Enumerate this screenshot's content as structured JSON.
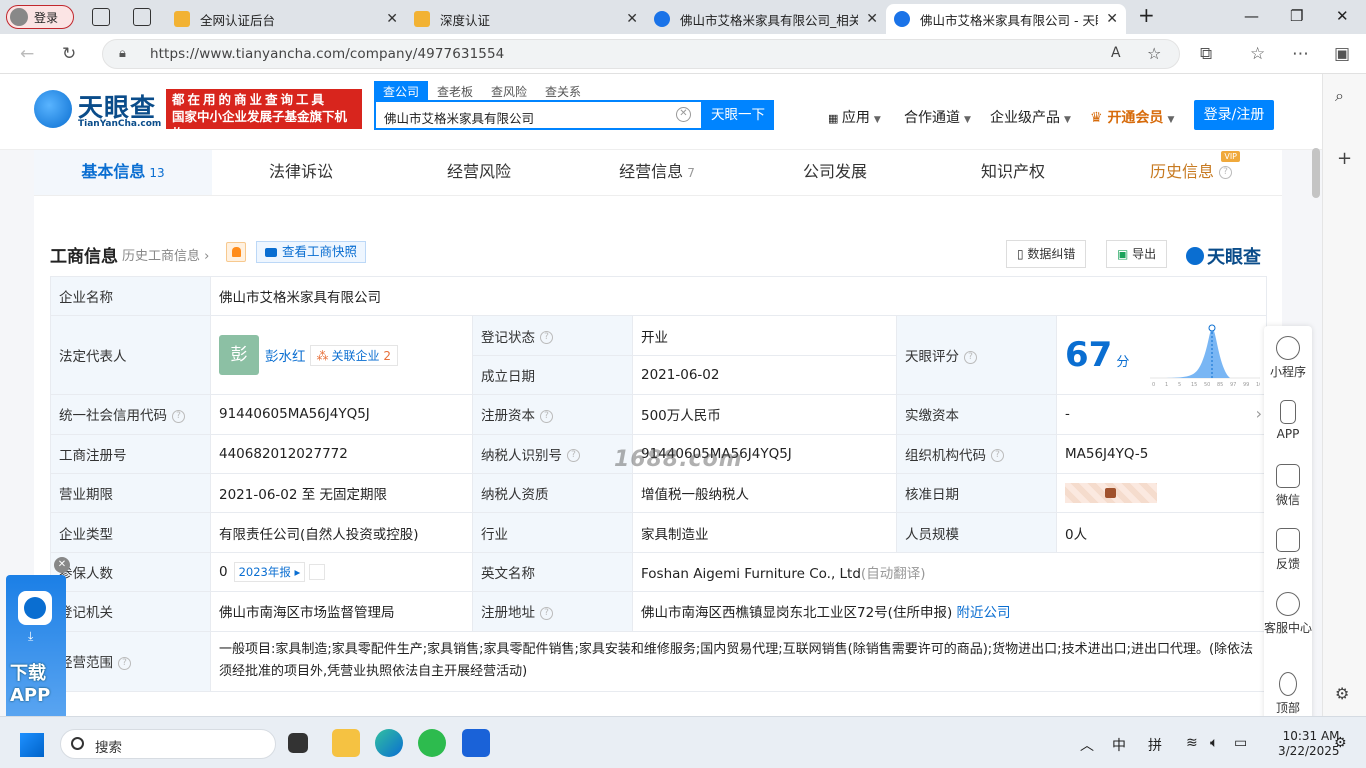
{
  "browser": {
    "login_label": "登录",
    "tabs": [
      {
        "label": "全网认证后台",
        "color": "#f2b233"
      },
      {
        "label": "深度认证",
        "color": "#f2b233"
      },
      {
        "label": "佛山市艾格米家具有限公司_相关",
        "color": "#1a73e8"
      },
      {
        "label": "佛山市艾格米家具有限公司 - 天眼",
        "color": "#1a73e8"
      }
    ],
    "new_tab_icon": "plus-icon",
    "url": "https://www.tianyancha.com/company/4977631554"
  },
  "header": {
    "logo_text": "天眼查",
    "logo_sub": "TianYanCha.com",
    "slogan_line1": "都在用的商业查询工具",
    "slogan_line2": "国家中小企业发展子基金旗下机构",
    "search_tabs": [
      "查公司",
      "查老板",
      "查风险",
      "查关系"
    ],
    "search_value": "佛山市艾格米家具有限公司",
    "search_button": "天眼一下",
    "nav": [
      "应用",
      "合作通道",
      "企业级产品",
      "开通会员"
    ],
    "login_button": "登录/注册"
  },
  "content_tabs": [
    {
      "label": "基本信息",
      "count": "13"
    },
    {
      "label": "法律诉讼",
      "count": ""
    },
    {
      "label": "经营风险",
      "count": ""
    },
    {
      "label": "经营信息",
      "count": "7"
    },
    {
      "label": "公司发展",
      "count": ""
    },
    {
      "label": "知识产权",
      "count": ""
    },
    {
      "label": "历史信息",
      "count": "",
      "badge": "VIP"
    }
  ],
  "section": {
    "title": "工商信息",
    "history_link": "历史工商信息",
    "snapshot_button": "查看工商快照",
    "report_error_button": "数据纠错",
    "export_button": "导出",
    "brand": "天眼查"
  },
  "info": {
    "company_name_label": "企业名称",
    "company_name": "佛山市艾格米家具有限公司",
    "legal_rep_label": "法定代表人",
    "legal_rep_avatar": "彭",
    "legal_rep_name": "彭水红",
    "related_label": "关联企业",
    "related_count": "2",
    "status_label": "登记状态",
    "status_value": "开业",
    "established_label": "成立日期",
    "established_value": "2021-06-02",
    "rating_label": "天眼评分",
    "rating_value": "67",
    "rating_unit": "分",
    "rating_axis": [
      "0",
      "1",
      "5",
      "15",
      "50",
      "85",
      "97",
      "99",
      "100"
    ],
    "credit_code_label": "统一社会信用代码",
    "credit_code": "91440605MA56J4YQ5J",
    "reg_capital_label": "注册资本",
    "reg_capital": "500万人民币",
    "paid_capital_label": "实缴资本",
    "paid_capital": "-",
    "reg_no_label": "工商注册号",
    "reg_no": "440682012027772",
    "taxpayer_id_label": "纳税人识别号",
    "taxpayer_id": "91440605MA56J4YQ5J",
    "org_code_label": "组织机构代码",
    "org_code": "MA56J4YQ-5",
    "term_label": "营业期限",
    "term_value": "2021-06-02 至 无固定期限",
    "taxpayer_qual_label": "纳税人资质",
    "taxpayer_qual": "增值税一般纳税人",
    "approval_date_label": "核准日期",
    "type_label": "企业类型",
    "type_value": "有限责任公司(自然人投资或控股)",
    "industry_label": "行业",
    "industry_value": "家具制造业",
    "staff_label": "人员规模",
    "staff_value": "0人",
    "insured_label": "参保人数",
    "insured_value": "0",
    "insured_year": "2023年报",
    "english_name_label": "英文名称",
    "english_name": "Foshan Aigemi Furniture Co., Ltd",
    "english_note": "(自动翻译)",
    "authority_label": "登记机关",
    "authority_value": "佛山市南海区市场监督管理局",
    "address_label": "注册地址",
    "address_value": "佛山市南海区西樵镇显岗东北工业区72号(住所申报)",
    "nearby_link": "附近公司",
    "scope_label": "经营范围",
    "scope_value": "一般项目:家具制造;家具零配件生产;家具销售;家具零配件销售;家具安装和维修服务;国内贸易代理;互联网销售(除销售需要许可的商品);货物进出口;技术进出口;进出口代理。(除依法须经批准的项目外,凭营业执照依法自主开展经营活动)"
  },
  "watermark": "1688.com",
  "floatbar": [
    "小程序",
    "APP",
    "微信",
    "反馈",
    "客服中心",
    "顶部"
  ],
  "download_app": {
    "line1": "下载",
    "line2": "APP"
  },
  "taskbar": {
    "search_placeholder": "搜索",
    "ime_lang": "中",
    "ime_mode": "拼",
    "time": "10:31 AM",
    "date": "3/22/2025"
  }
}
